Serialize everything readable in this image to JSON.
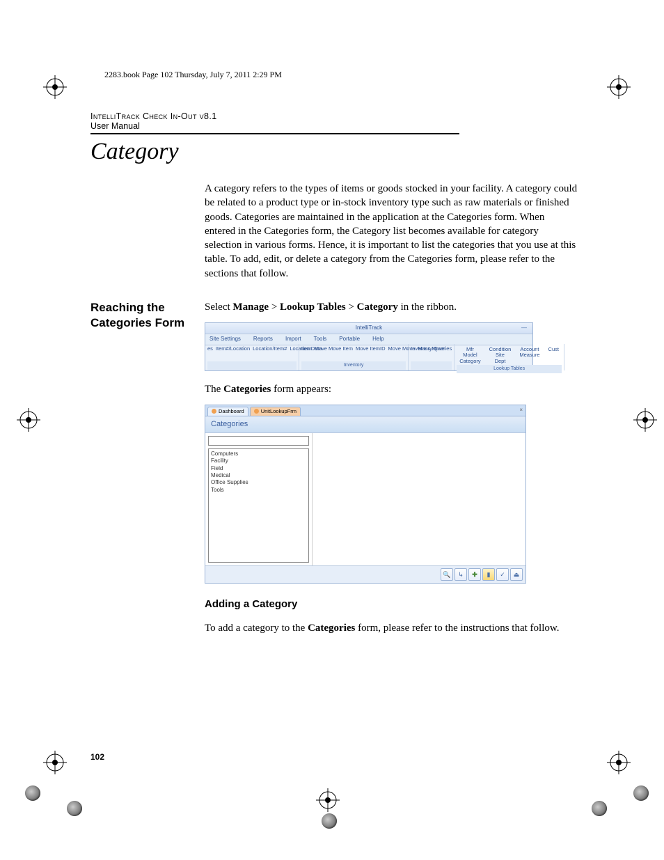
{
  "book_header": "2283.book  Page 102  Thursday, July 7, 2011  2:29 PM",
  "doc_title": "IntelliTrack Check In-Out v8.1",
  "doc_subtitle": "User Manual",
  "section_title": "Category",
  "intro_para": "A category refers to the types of items or goods stocked in your facility. A category could be related to a product type or in-stock inventory type such as raw materials or finished goods. Categories are maintained in the application at the Categories form. When entered in the Categories form, the Category list becomes available for category selection in various forms. Hence, it is important to list the categories that you use at this table. To add, edit, or delete a category from the Categories form, please refer to the sections that follow.",
  "margin_heading_1": "Reaching the Categories Form",
  "reach_sentence_pre": "Select ",
  "reach_nav_1": "Manage",
  "reach_nav_sep": " > ",
  "reach_nav_2": "Lookup Tables",
  "reach_nav_3": "Category",
  "reach_sentence_post": " in the ribbon.",
  "ribbon": {
    "title": "IntelliTrack",
    "tabs": [
      "Site Settings",
      "Reports",
      "Import",
      "Tools",
      "Portable",
      "Help"
    ],
    "left_group_items": [
      "es",
      "Item#/Location",
      "Location/Item#",
      "Location Data"
    ],
    "inventory_items": [
      "Item",
      "Move Move Item",
      "Move ItemID",
      "Move Move",
      "Mass Move"
    ],
    "inventory_queries": "Inventory Queries",
    "inventory_group": "Inventory",
    "lookup_cols": [
      [
        "Mfr",
        "Model",
        "Category"
      ],
      [
        "Condition",
        "Site",
        "Dept"
      ],
      [
        "Account",
        "Measure"
      ]
    ],
    "lookup_group": "Lookup Tables",
    "cust": "Cust"
  },
  "appears_text": "The Categories form appears:",
  "catform": {
    "tab1": "Dashboard",
    "tab2": "UnitLookupFrm",
    "header": "Categories",
    "items": [
      "Computers",
      "Facility",
      "Field",
      "Medical",
      "Office Supplies",
      "Tools"
    ]
  },
  "sub_heading": "Adding a Category",
  "add_para": "To add a category to the Categories form, please refer to the instructions that follow.",
  "page_num": "102"
}
